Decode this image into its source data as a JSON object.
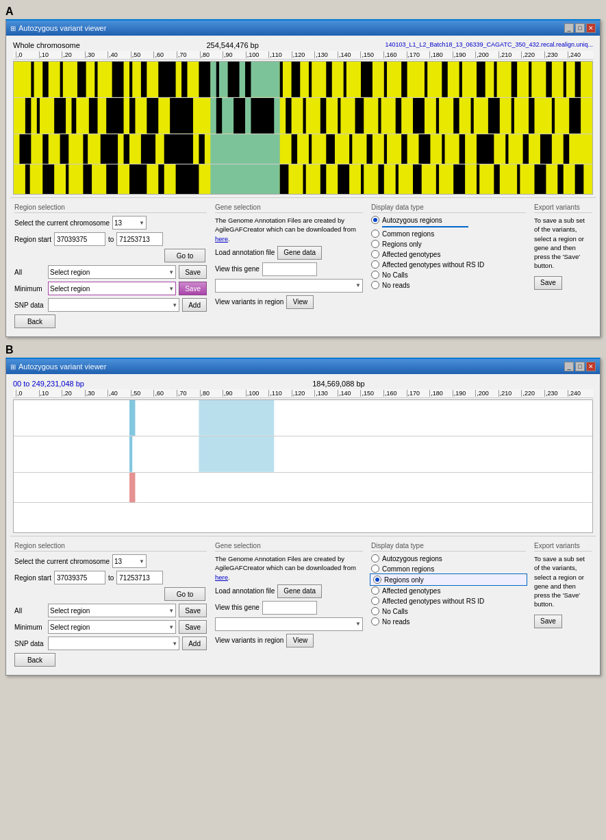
{
  "panelA": {
    "label": "A",
    "window": {
      "title": "Autozygous  variant viewer",
      "info_left": "Whole chromosome",
      "info_bp": "254,544,476 bp",
      "info_file": "140103_L1_L2_Batch18_13_06339_CAGATC_350_432.recal.realign.uniq...",
      "ruler_start": "0",
      "ruler_ticks": [
        "0",
        ",10",
        ",20",
        ",30",
        ",40",
        ",50",
        ",60",
        ",70",
        ",80",
        ",90",
        ",100",
        ",110",
        ",120",
        ",130",
        ",140",
        ",150",
        ",160",
        ",170",
        ",180",
        ",190",
        ",200",
        ",210",
        ",220",
        ",230",
        ",240"
      ]
    },
    "controls": {
      "region_selection": {
        "title": "Region selection",
        "chromosome_label": "Select the current chromosome",
        "chromosome_value": "13",
        "region_start_label": "Region start",
        "region_start_value": "37039375",
        "to_label": "to",
        "region_end_value": "71253713",
        "goto_label": "Go to",
        "all_label": "All",
        "all_select": "Select region",
        "all_save": "Save",
        "minimum_label": "Minimum",
        "minimum_select": "Select region",
        "minimum_save": "Save",
        "snp_label": "SNP data",
        "snp_add": "Add",
        "back_label": "Back"
      },
      "gene_selection": {
        "title": "Gene selection",
        "annotation_text": "The Genome Annotation Files are created by AgileGAFCreator which can be downloaded from",
        "annotation_link": "here",
        "load_label": "Load annotation file",
        "load_btn": "Gene data",
        "view_gene_label": "View this gene",
        "view_variants_label": "View variants in region",
        "view_btn": "View"
      },
      "display_type": {
        "title": "Display data type",
        "options": [
          {
            "label": "Autozygous regions",
            "selected": true
          },
          {
            "label": "Common regions",
            "selected": false
          },
          {
            "label": "Regions only",
            "selected": false
          },
          {
            "label": "Affected genotypes",
            "selected": false
          },
          {
            "label": "Affected genotypes without RS ID",
            "selected": false
          },
          {
            "label": "No Calls",
            "selected": false
          },
          {
            "label": "No reads",
            "selected": false
          }
        ]
      },
      "export": {
        "title": "Export variants",
        "text": "To save a sub set of the variants, select a region or gene and then press the 'Save' button.",
        "save_label": "Save"
      }
    }
  },
  "panelB": {
    "label": "B",
    "window": {
      "title": "Autozygous  variant viewer",
      "info_left": "00 to 249,231,048 bp",
      "info_bp": "184,569,088 bp",
      "ruler_ticks": [
        "0",
        ",10",
        ",20",
        ",30",
        ",40",
        ",50",
        ",60",
        ",70",
        ",80",
        ",90",
        ",100",
        ",110",
        ",120",
        ",130",
        ",140",
        ",150",
        ",160",
        ",170",
        ",180",
        ",190",
        ",200",
        ",210",
        ",220",
        ",230",
        ",240"
      ]
    },
    "controls": {
      "region_selection": {
        "title": "Region selection",
        "chromosome_label": "Select the current chromosome",
        "chromosome_value": "13",
        "region_start_label": "Region start",
        "region_start_value": "37039375",
        "to_label": "to",
        "region_end_value": "71253713",
        "goto_label": "Go to",
        "all_label": "All",
        "all_select": "Select region",
        "all_save": "Save",
        "minimum_label": "Minimum",
        "minimum_select": "Select region",
        "minimum_save": "Save",
        "snp_label": "SNP data",
        "snp_add": "Add",
        "back_label": "Back"
      },
      "gene_selection": {
        "title": "Gene selection",
        "annotation_text": "The Genome Annotation Files are created by AgileGAFCreator which can be downloaded from",
        "annotation_link": "here",
        "load_label": "Load annotation file",
        "load_btn": "Gene data",
        "view_gene_label": "View this gene",
        "view_variants_label": "View variants in region",
        "view_btn": "View"
      },
      "display_type": {
        "title": "Display data type",
        "options": [
          {
            "label": "Autozygous regions",
            "selected": false
          },
          {
            "label": "Common regions",
            "selected": false
          },
          {
            "label": "Regions only",
            "selected": true
          },
          {
            "label": "Affected genotypes",
            "selected": false
          },
          {
            "label": "Affected genotypes without RS ID",
            "selected": false
          },
          {
            "label": "No Calls",
            "selected": false
          },
          {
            "label": "No reads",
            "selected": false
          }
        ]
      },
      "export": {
        "title": "Export variants",
        "text": "To save a sub set of the variants, select a region or gene and then press the 'Save' button.",
        "save_label": "Save"
      }
    }
  }
}
